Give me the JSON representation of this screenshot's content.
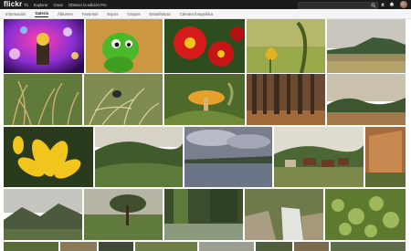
{
  "header": {
    "brand": "flickr",
    "nav": [
      "Tú",
      "Explorar",
      "Crear",
      "Obtener la edición Pro"
    ],
    "search_placeholder": "",
    "icons": [
      "search-icon",
      "upload-icon",
      "bell-icon"
    ]
  },
  "tabs": [
    {
      "label": "Información",
      "active": false
    },
    {
      "label": "Galería",
      "active": true
    },
    {
      "label": "Álbumes",
      "active": false
    },
    {
      "label": "Favoritos",
      "active": false
    },
    {
      "label": "Expos",
      "active": false
    },
    {
      "label": "Grupos",
      "active": false
    },
    {
      "label": "Estadísticas",
      "active": false
    },
    {
      "label": "Cámara fotográfica",
      "active": false
    }
  ],
  "colors": {
    "topbar": "#1b1b1b",
    "subbar": "#f5f5f5",
    "text_dark": "#212121"
  }
}
